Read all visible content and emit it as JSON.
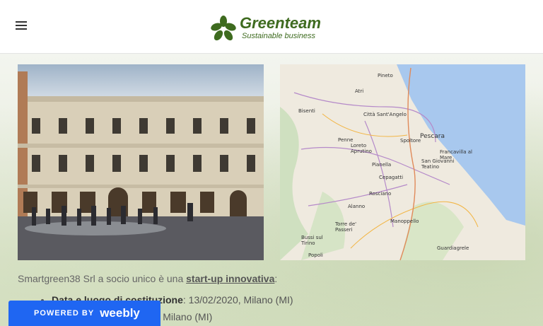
{
  "header": {
    "brand_name": "Greenteam",
    "brand_tagline": "Sustainable business",
    "menu_icon": "hamburger-icon",
    "accent_color": "#3e6b1f"
  },
  "map": {
    "labels": [
      "Pineto",
      "Atri",
      "Bisenti",
      "Città Sant'Angelo",
      "Penne",
      "Loreto Aprutino",
      "Pescara",
      "Spoltore",
      "Francavilla al Mare",
      "San Giovanni Teatino",
      "Pianella",
      "Cepagatti",
      "Rosciano",
      "Alanno",
      "Manoppello",
      "Torre de' Passeri",
      "Bussi sul Tirino",
      "Popoli",
      "Guardiagrele"
    ]
  },
  "content": {
    "intro_prefix": "Smartgreen38 Srl  a socio unico è una ",
    "intro_link": "start-up innovativa",
    "intro_suffix": ":",
    "items": [
      {
        "label": "Data e luogo di costituzione",
        "value": ": 13/02/2020, Milano (MI)"
      },
      {
        "label": "",
        "value": "139 Milano (MI)"
      }
    ]
  },
  "badge": {
    "powered": "POWERED BY",
    "brand": "weebly",
    "color": "#1f66f2"
  }
}
